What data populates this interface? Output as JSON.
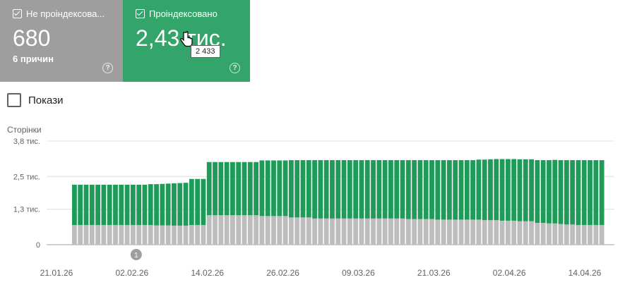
{
  "cards": [
    {
      "title": "Не проіндексова...",
      "value": "680",
      "sub": "6 причин",
      "help": "?"
    },
    {
      "title": "Проіндексовано",
      "value": "2,43 тис.",
      "help": "?"
    }
  ],
  "tooltip": "2 433",
  "show_toggle": {
    "label": "Покази"
  },
  "colors": {
    "indexed": "#1e9b58",
    "not_indexed": "#bdbdbd",
    "card_gray": "#9e9e9e",
    "card_green": "#33a56a"
  },
  "chart_data": {
    "type": "bar",
    "stacked": true,
    "ylabel": "Сторінки",
    "y_ticks": [
      "3,8 тис.",
      "2,5 тис.",
      "1,3 тис.",
      "0"
    ],
    "y_tick_values": [
      3800,
      2500,
      1300,
      0
    ],
    "ylim": [
      0,
      3800
    ],
    "x_tick_labels": [
      "21.01.26",
      "02.02.26",
      "14.02.26",
      "26.02.26",
      "09.03.26",
      "21.03.26",
      "02.04.26",
      "14.04.26"
    ],
    "annotation": {
      "label": "1",
      "date": "02.02.26"
    },
    "series": [
      {
        "name": "Не проіндексовано",
        "values": [
          720,
          720,
          720,
          720,
          720,
          720,
          720,
          720,
          720,
          720,
          720,
          720,
          720,
          720,
          710,
          710,
          710,
          700,
          700,
          700,
          720,
          720,
          720,
          1080,
          1080,
          1080,
          1080,
          1080,
          1080,
          1080,
          1080,
          1080,
          1050,
          1050,
          1050,
          1050,
          1050,
          1000,
          1000,
          1000,
          1000,
          960,
          960,
          960,
          960,
          960,
          960,
          960,
          960,
          960,
          960,
          960,
          960,
          960,
          960,
          960,
          960,
          940,
          940,
          940,
          940,
          940,
          920,
          920,
          920,
          920,
          920,
          920,
          920,
          920,
          900,
          900,
          900,
          880,
          880,
          880,
          860,
          860,
          860,
          800,
          800,
          780,
          780,
          760,
          740,
          740,
          720,
          720,
          720,
          720,
          720
        ]
      },
      {
        "name": "Проіндексовано",
        "values": [
          1480,
          1480,
          1480,
          1480,
          1480,
          1480,
          1480,
          1480,
          1480,
          1480,
          1480,
          1480,
          1480,
          1500,
          1510,
          1520,
          1530,
          1550,
          1560,
          1570,
          1690,
          1690,
          1690,
          1950,
          1950,
          1950,
          1950,
          1950,
          1950,
          1950,
          1950,
          1950,
          2040,
          2040,
          2040,
          2040,
          2040,
          2100,
          2100,
          2100,
          2100,
          2140,
          2140,
          2140,
          2140,
          2140,
          2140,
          2140,
          2140,
          2140,
          2140,
          2140,
          2140,
          2140,
          2140,
          2140,
          2140,
          2160,
          2160,
          2160,
          2160,
          2160,
          2180,
          2180,
          2180,
          2180,
          2180,
          2180,
          2180,
          2200,
          2220,
          2230,
          2240,
          2260,
          2260,
          2260,
          2270,
          2270,
          2270,
          2300,
          2300,
          2320,
          2330,
          2340,
          2360,
          2360,
          2380,
          2380,
          2380,
          2380,
          2380
        ]
      }
    ]
  }
}
